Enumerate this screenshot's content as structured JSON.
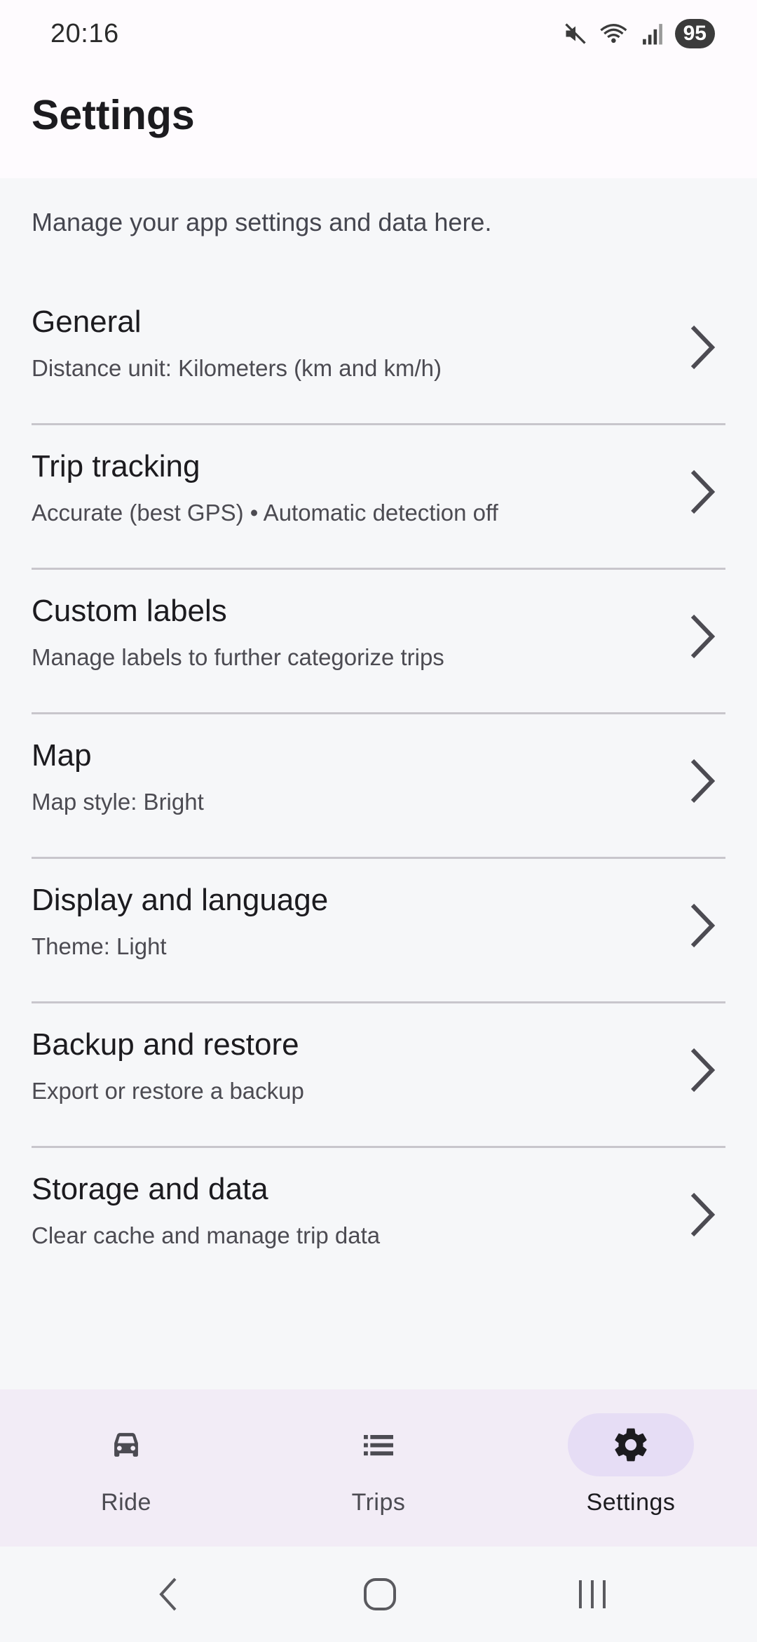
{
  "status_bar": {
    "time": "20:16",
    "battery": "95"
  },
  "app_bar": {
    "title": "Settings"
  },
  "intro": "Manage your app settings and data here.",
  "items": [
    {
      "title": "General",
      "subtitle": "Distance unit: Kilometers (km and km/h)"
    },
    {
      "title": "Trip tracking",
      "subtitle": "Accurate (best GPS) • Automatic detection off"
    },
    {
      "title": "Custom labels",
      "subtitle": "Manage labels to further categorize trips"
    },
    {
      "title": "Map",
      "subtitle": "Map style: Bright"
    },
    {
      "title": "Display and language",
      "subtitle": "Theme: Light"
    },
    {
      "title": "Backup and restore",
      "subtitle": "Export or restore a backup"
    },
    {
      "title": "Storage and data",
      "subtitle": "Clear cache and manage trip data"
    }
  ],
  "bottom_nav": [
    {
      "label": "Ride",
      "icon": "car-icon",
      "active": false
    },
    {
      "label": "Trips",
      "icon": "list-icon",
      "active": false
    },
    {
      "label": "Settings",
      "icon": "gear-icon",
      "active": true
    }
  ],
  "colors": {
    "accent_pill": "#e6ddf5",
    "nav_background": "#f2ecf6",
    "page_background": "#f6f7f9"
  }
}
